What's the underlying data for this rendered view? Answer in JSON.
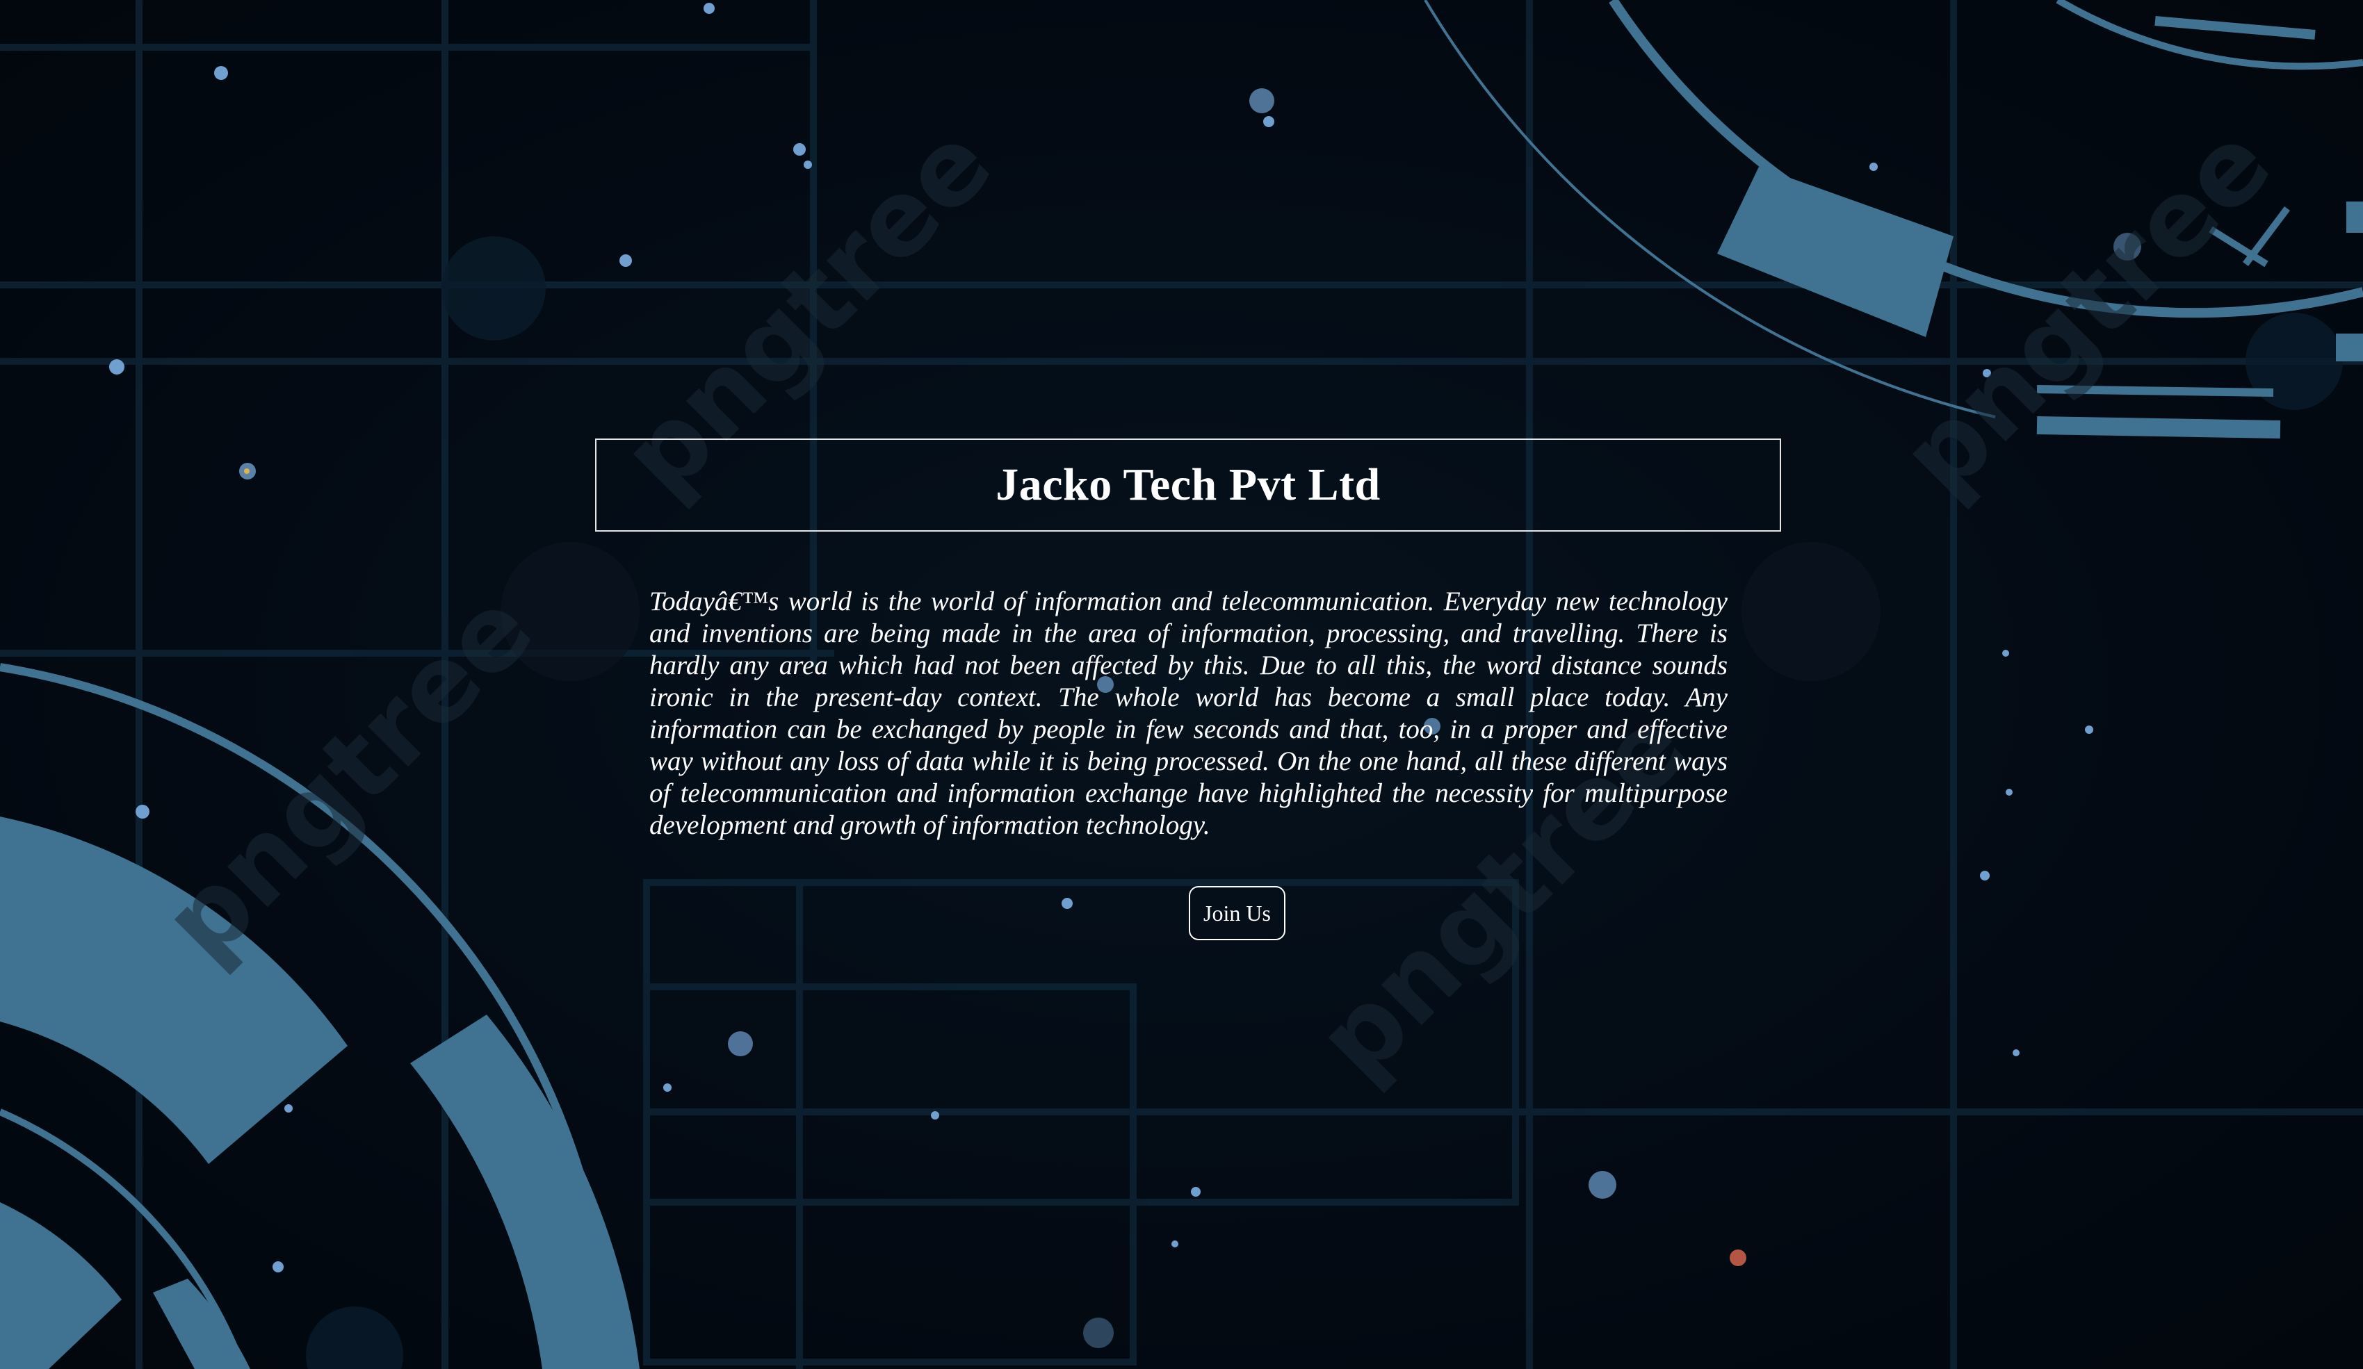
{
  "header": {
    "title": "Jacko Tech Pvt Ltd"
  },
  "main": {
    "paragraph": "Todayâ€™s world is the world of information and telecommunication. Everyday new technology and inventions are being made in the area of information, processing, and travelling. There is hardly any area which had not been affected by this. Due to all this, the word distance sounds ironic in the present-day context. The whole world has become a small place today. Any information can be exchanged by people in few seconds and that, too, in a proper and effective way without any loss of data while it is being processed. On the one hand, all these different ways of telecommunication and information exchange have highlighted the necessity for multipurpose development and growth of information technology.",
    "join_button_label": "Join Us"
  },
  "background": {
    "watermark_text": "pngtree",
    "base_color": "#030a12",
    "accent_color": "#3d6f8a"
  }
}
